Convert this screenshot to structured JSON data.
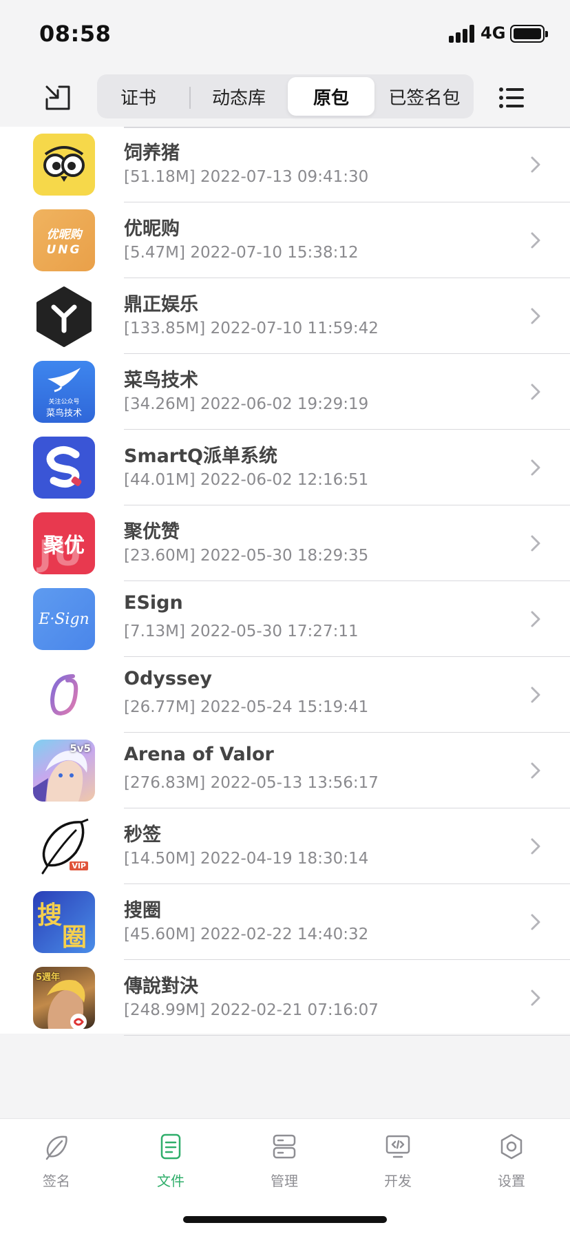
{
  "status_bar": {
    "time": "08:58",
    "network": "4G"
  },
  "tabs_segment": {
    "items": [
      {
        "label": "证书",
        "active": false
      },
      {
        "label": "动态库",
        "active": false
      },
      {
        "label": "原包",
        "active": true
      },
      {
        "label": "已签名包",
        "active": false
      }
    ]
  },
  "files": [
    {
      "name": "饲养猪",
      "meta": "[51.18M] 2022-07-13 09:41:30",
      "icon": "owl-icon"
    },
    {
      "name": "优昵购",
      "meta": "[5.47M] 2022-07-10 15:38:12",
      "icon": "ung-icon",
      "icon_text_1": "优昵购",
      "icon_text_2": "UNG"
    },
    {
      "name": "鼎正娱乐",
      "meta": "[133.85M] 2022-07-10 11:59:42",
      "icon": "cube-y-icon"
    },
    {
      "name": "菜鸟技术",
      "meta": "[34.26M] 2022-06-02 19:29:19",
      "icon": "bird-icon",
      "icon_text_1": "关注公众号",
      "icon_text_2": "菜鸟技术"
    },
    {
      "name": "SmartQ派单系统",
      "meta": "[44.01M] 2022-06-02 12:16:51",
      "icon": "smartq-icon"
    },
    {
      "name": "聚优赞",
      "meta": "[23.60M] 2022-05-30 18:29:35",
      "icon": "juyou-icon",
      "icon_text_1": "聚优",
      "icon_text_2": "JU"
    },
    {
      "name": "ESign",
      "meta": "[7.13M] 2022-05-30 17:27:11",
      "icon": "esign-icon",
      "icon_text_1": "E·Sign"
    },
    {
      "name": "Odyssey",
      "meta": "[26.77M] 2022-05-24 15:19:41",
      "icon": "odyssey-icon"
    },
    {
      "name": "Arena of Valor",
      "meta": "[276.83M] 2022-05-13 13:56:17",
      "icon": "arena-icon",
      "icon_text_1": "5v5"
    },
    {
      "name": "秒签",
      "meta": "[14.50M] 2022-04-19 18:30:14",
      "icon": "feather-icon",
      "icon_text_1": "VIP"
    },
    {
      "name": "搜圈",
      "meta": "[45.60M] 2022-02-22 14:40:32",
      "icon": "souquan-icon",
      "icon_text_1": "搜",
      "icon_text_2": "圈"
    },
    {
      "name": "傳說對決",
      "meta": "[248.99M] 2022-02-21 07:16:07",
      "icon": "legend-icon",
      "icon_text_1": "5週年"
    }
  ],
  "tab_bar": {
    "items": [
      {
        "label": "签名",
        "icon": "leaf-icon",
        "active": false
      },
      {
        "label": "文件",
        "icon": "document-icon",
        "active": true
      },
      {
        "label": "管理",
        "icon": "server-icon",
        "active": false
      },
      {
        "label": "开发",
        "icon": "code-monitor-icon",
        "active": false
      },
      {
        "label": "设置",
        "icon": "gear-icon",
        "active": false
      }
    ]
  },
  "colors": {
    "accent": "#2fae6a",
    "background": "#f4f4f5",
    "text": "#444444",
    "secondary_text": "#8a8a8e"
  }
}
